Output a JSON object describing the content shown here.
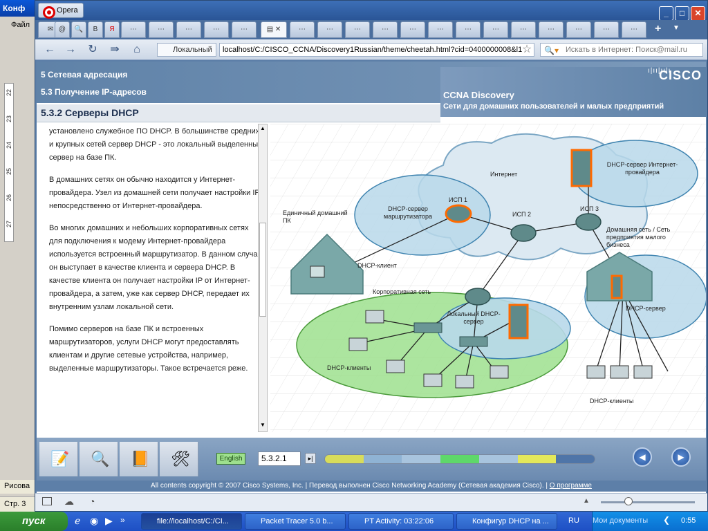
{
  "word": {
    "title": "Конф",
    "menu_file": "Файл",
    "ruler_numbers": [
      "22",
      "23",
      "24",
      "25",
      "26",
      "27"
    ],
    "draw_label": "Рисова",
    "status_page": "Стр. 3"
  },
  "opera": {
    "button_label": "Opera",
    "nav_local": "Локальный",
    "address": "localhost/C:/CISCO_CCNA/Discovery1Russian/theme/cheetah.html?cid=0400000008&l1",
    "search_placeholder": "Искать в Интернет: Поиск@mail.ru"
  },
  "course": {
    "chapter": "5 Сетевая адресация",
    "section": "5.3 Получение IP-адресов",
    "topic": "5.3.2 Серверы DHCP",
    "brand_title": "CCNA Discovery",
    "brand_subtitle": "Сети для домашних пользователей и малых предприятий",
    "cisco_logo": "CISCO",
    "paragraphs": [
      "установлено служебное ПО DHCP. В большинстве средних и крупных сетей сервер DHCP - это локальный выделенный сервер на базе ПК.",
      "В домашних сетях он обычно находится у Интернет-провайдера. Узел из домашней сети получает настройки IP непосредственно от Интернет-провайдера.",
      "Во многих домашних и небольших корпоративных сетях для подключения к модему Интернет-провайдера используется встроенный маршрутизатор. В данном случае он выступает в качестве клиента и сервера DHCP. В качестве клиента он получает настройки IP от Интернет-провайдера, а затем, уже как сервер DHCP, передает их внутренним узлам локальной сети.",
      "Помимо серверов на базе ПК и встроенных маршрутизаторов, услуги DHCP могут предоставлять клиентам и другие сетевые устройства, например, выделенные маршрутизаторы. Такое встречается реже."
    ],
    "diagram": {
      "internet": "Интернет",
      "isp_dhcp": "DHCP-сервер Интернет-провайдера",
      "router_dhcp": "DHCP-сервер маршрутизатора",
      "isp1": "ИСП 1",
      "isp2": "ИСП 2",
      "isp3": "ИСП 3",
      "home_pc": "Единичный домашний ПК",
      "dhcp_client": "DHCP-клиент",
      "home_small": "Домашняя сеть / Сеть предприятия малого бизнеса",
      "corp_net": "Корпоративная сеть",
      "local_dhcp": "Локальный DHCP-сервер",
      "dhcp_server": "DHCP-сервер",
      "dhcp_clients_left": "DHCP-клиенты",
      "dhcp_clients_right": "DHCP-клиенты"
    },
    "language_button": "English",
    "page_number": "5.3.2.1",
    "copyright": "All contents copyright © 2007 Cisco Systems, Inc. | Перевод выполнен Cisco Networking Academy (Сетевая академия Cisco). | ",
    "about_link": "О программе"
  },
  "taskbar": {
    "start": "пуск",
    "tasks": [
      "file://localhost/C:/CI...",
      "Packet Tracer 5.0 b...",
      "PT Activity: 03:22:06",
      "Конфигур DHCP на ..."
    ],
    "lang": "RU",
    "my_docs": "Мои документы",
    "clock": "0:55"
  },
  "colors": {
    "header_blue": "#6b8cb2",
    "internet_cloud": "#dce9f2",
    "home_network": "#b8d8ea",
    "corp_network": "#9ee08e",
    "dhcp_highlight": "#ff6a00"
  }
}
